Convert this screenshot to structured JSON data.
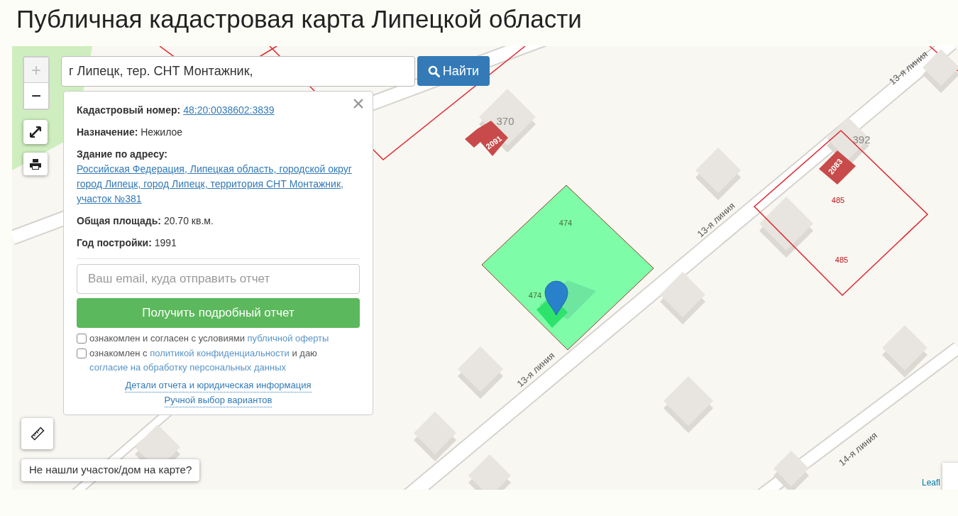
{
  "title": "Публичная кадастровая карта Липецкой области",
  "search": {
    "value": "г Липецк, тер. СНТ Монтажник,",
    "button": "Найти"
  },
  "zoom": [
    {
      "label": "+",
      "disabled": true
    },
    {
      "label": "−",
      "disabled": false
    }
  ],
  "popup": {
    "fields": [
      {
        "label": "Кадастровый номер:",
        "value": "48:20:0038602:3839",
        "kind": "link"
      },
      {
        "label": "Назначение:",
        "value": "Нежилое",
        "kind": "text"
      },
      {
        "label": "Здание по адресу:",
        "value": "Российская Федерация, Липецкая область, городской округ город Липецк, город Липецк, территория СНТ Монтажник, участок №381",
        "kind": "link"
      },
      {
        "label": "Общая площадь:",
        "value": "20.70 кв.м.",
        "kind": "text"
      },
      {
        "label": "Год постройки:",
        "value": "1991",
        "kind": "text"
      }
    ],
    "email": {
      "placeholder": "Ваш email, куда отправить отчет"
    },
    "submit": "Получить подробный отчет",
    "consents": [
      {
        "checked": false,
        "parts": [
          {
            "text": "ознакомлен и согласен с условиями",
            "kind": "text"
          },
          {
            "text": "публичной оферты",
            "kind": "link"
          }
        ]
      },
      {
        "checked": false,
        "parts": [
          {
            "text": "ознакомлен с",
            "kind": "text"
          },
          {
            "text": "политикой конфиденциальности",
            "kind": "link"
          },
          {
            "text": "и даю",
            "kind": "text"
          },
          {
            "text": "согласие на обработку персональных данных",
            "kind": "link"
          }
        ]
      }
    ],
    "links": [
      "Детали отчета и юридическая информация",
      "Ручной выбор вариантов"
    ]
  },
  "map": {
    "labels": [
      {
        "text": "370",
        "kind": "house"
      },
      {
        "text": "2091",
        "kind": "building"
      },
      {
        "text": "392",
        "kind": "house"
      },
      {
        "text": "2083",
        "kind": "building"
      },
      {
        "text": "485",
        "kind": "parcel"
      },
      {
        "text": "485",
        "kind": "parcel"
      },
      {
        "text": "474",
        "kind": "selected"
      },
      {
        "text": "474",
        "kind": "selected"
      },
      {
        "text": "13-я линия",
        "kind": "street"
      },
      {
        "text": "13-я линия",
        "kind": "street"
      },
      {
        "text": "13-я линия",
        "kind": "street"
      },
      {
        "text": "14-я линия",
        "kind": "street"
      }
    ]
  },
  "help_button": "Не нашли участок/дом на карте?",
  "attribution": "Leafl"
}
